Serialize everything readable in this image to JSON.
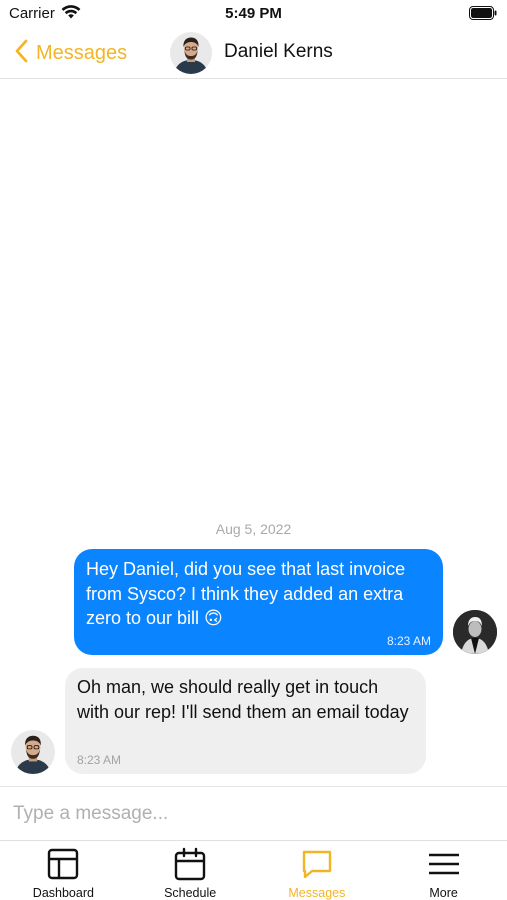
{
  "status_bar": {
    "carrier": "Carrier",
    "time": "5:49 PM"
  },
  "nav": {
    "back_label": "Messages",
    "contact_name": "Daniel Kerns"
  },
  "chat": {
    "date": "Aug 5, 2022",
    "messages": [
      {
        "direction": "outgoing",
        "text": "Hey Daniel, did you see that last invoice from Sysco? I think they added an extra zero to our bill 🙃",
        "time": "8:23 AM"
      },
      {
        "direction": "incoming",
        "text": "Oh man, we should really get in touch with our rep! I'll send them an email today",
        "time": "8:23 AM"
      }
    ]
  },
  "input": {
    "placeholder": "Type a message..."
  },
  "tabs": [
    {
      "label": "Dashboard",
      "icon": "dashboard-icon",
      "active": false
    },
    {
      "label": "Schedule",
      "icon": "calendar-icon",
      "active": false
    },
    {
      "label": "Messages",
      "icon": "chat-bubble-icon",
      "active": true
    },
    {
      "label": "More",
      "icon": "hamburger-menu-icon",
      "active": false
    }
  ],
  "colors": {
    "accent": "#f2b526",
    "outgoing_bubble": "#0a84ff",
    "incoming_bubble": "#efefef"
  }
}
